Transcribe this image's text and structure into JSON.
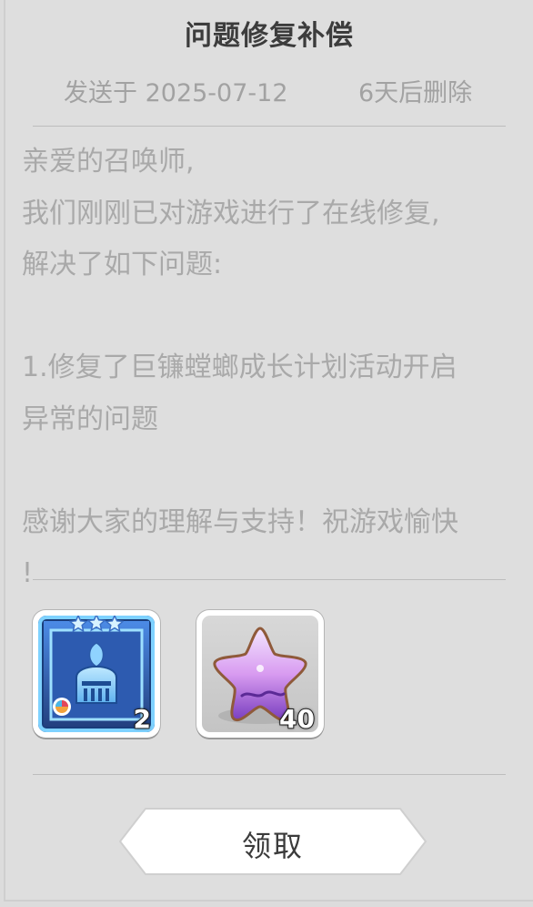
{
  "mail": {
    "title": "问题修复补偿",
    "sent_date": "发送于 2025-07-12",
    "expire_note": "6天后删除",
    "body_lines": [
      "亲爱的召唤师,",
      "我们刚刚已对游戏进行了在线修复,",
      "解决了如下问题:",
      "",
      "1.修复了巨镰螳螂成长计划活动开启",
      "异常的问题",
      "",
      "感谢大家的理解与支持！祝游戏愉快",
      "!"
    ]
  },
  "rewards": [
    {
      "icon": "knight-card-icon",
      "stars": 3,
      "count": "2",
      "frame_color": "#3d7bd8"
    },
    {
      "icon": "purple-star-icon",
      "count": "40",
      "frame_color": "#c4c4c4"
    }
  ],
  "actions": {
    "claim_label": "领取"
  },
  "colors": {
    "background": "#dedede",
    "title": "#3c3c3c",
    "muted_text": "#a9a9a9",
    "divider": "#bdbdbd"
  }
}
